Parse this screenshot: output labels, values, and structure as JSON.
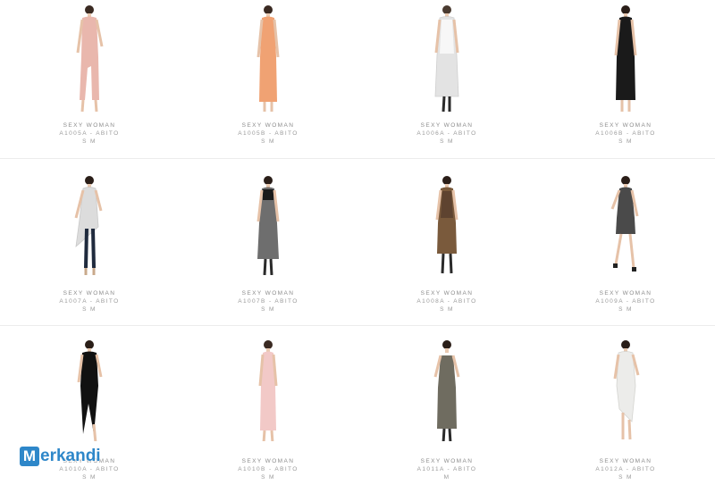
{
  "products": [
    {
      "brand": "SEXY WOMAN",
      "code": "A1005A - ABITO",
      "sizes": "S M",
      "dress_color": "#e9b7ad",
      "style": "long-slit"
    },
    {
      "brand": "SEXY WOMAN",
      "code": "A1005B - ABITO",
      "sizes": "S M",
      "dress_color": "#f0a273",
      "style": "long"
    },
    {
      "brand": "SEXY WOMAN",
      "code": "A1006A - ABITO",
      "sizes": "S M",
      "dress_color": "#e3e3e3",
      "style": "layered"
    },
    {
      "brand": "SEXY WOMAN",
      "code": "A1006B - ABITO",
      "sizes": "S M",
      "dress_color": "#1a1a1a",
      "style": "layered"
    },
    {
      "brand": "SEXY WOMAN",
      "code": "A1007A - ABITO",
      "sizes": "S M",
      "dress_color": "#dcdcdc",
      "style": "top-jeans"
    },
    {
      "brand": "SEXY WOMAN",
      "code": "A1007B - ABITO",
      "sizes": "S M",
      "dress_color": "#555555",
      "style": "sheer"
    },
    {
      "brand": "SEXY WOMAN",
      "code": "A1008A - ABITO",
      "sizes": "S M",
      "dress_color": "#7a5a3c",
      "style": "sheer"
    },
    {
      "brand": "SEXY WOMAN",
      "code": "A1009A - ABITO",
      "sizes": "S M",
      "dress_color": "#4a4a4a",
      "style": "short"
    },
    {
      "brand": "SEXY WOMAN",
      "code": "A1010A - ABITO",
      "sizes": "S M",
      "dress_color": "#111111",
      "style": "asym"
    },
    {
      "brand": "SEXY WOMAN",
      "code": "A1010B - ABITO",
      "sizes": "S M",
      "dress_color": "#f2c9c7",
      "style": "long"
    },
    {
      "brand": "SEXY WOMAN",
      "code": "A1011A - ABITO",
      "sizes": "M",
      "dress_color": "#6f6c60",
      "style": "strapless"
    },
    {
      "brand": "SEXY WOMAN",
      "code": "A1012A - ABITO",
      "sizes": "S M",
      "dress_color": "#ececea",
      "style": "asym"
    }
  ],
  "watermark": {
    "text": "Merkandi",
    "icon": "merkandi-logo-icon"
  }
}
